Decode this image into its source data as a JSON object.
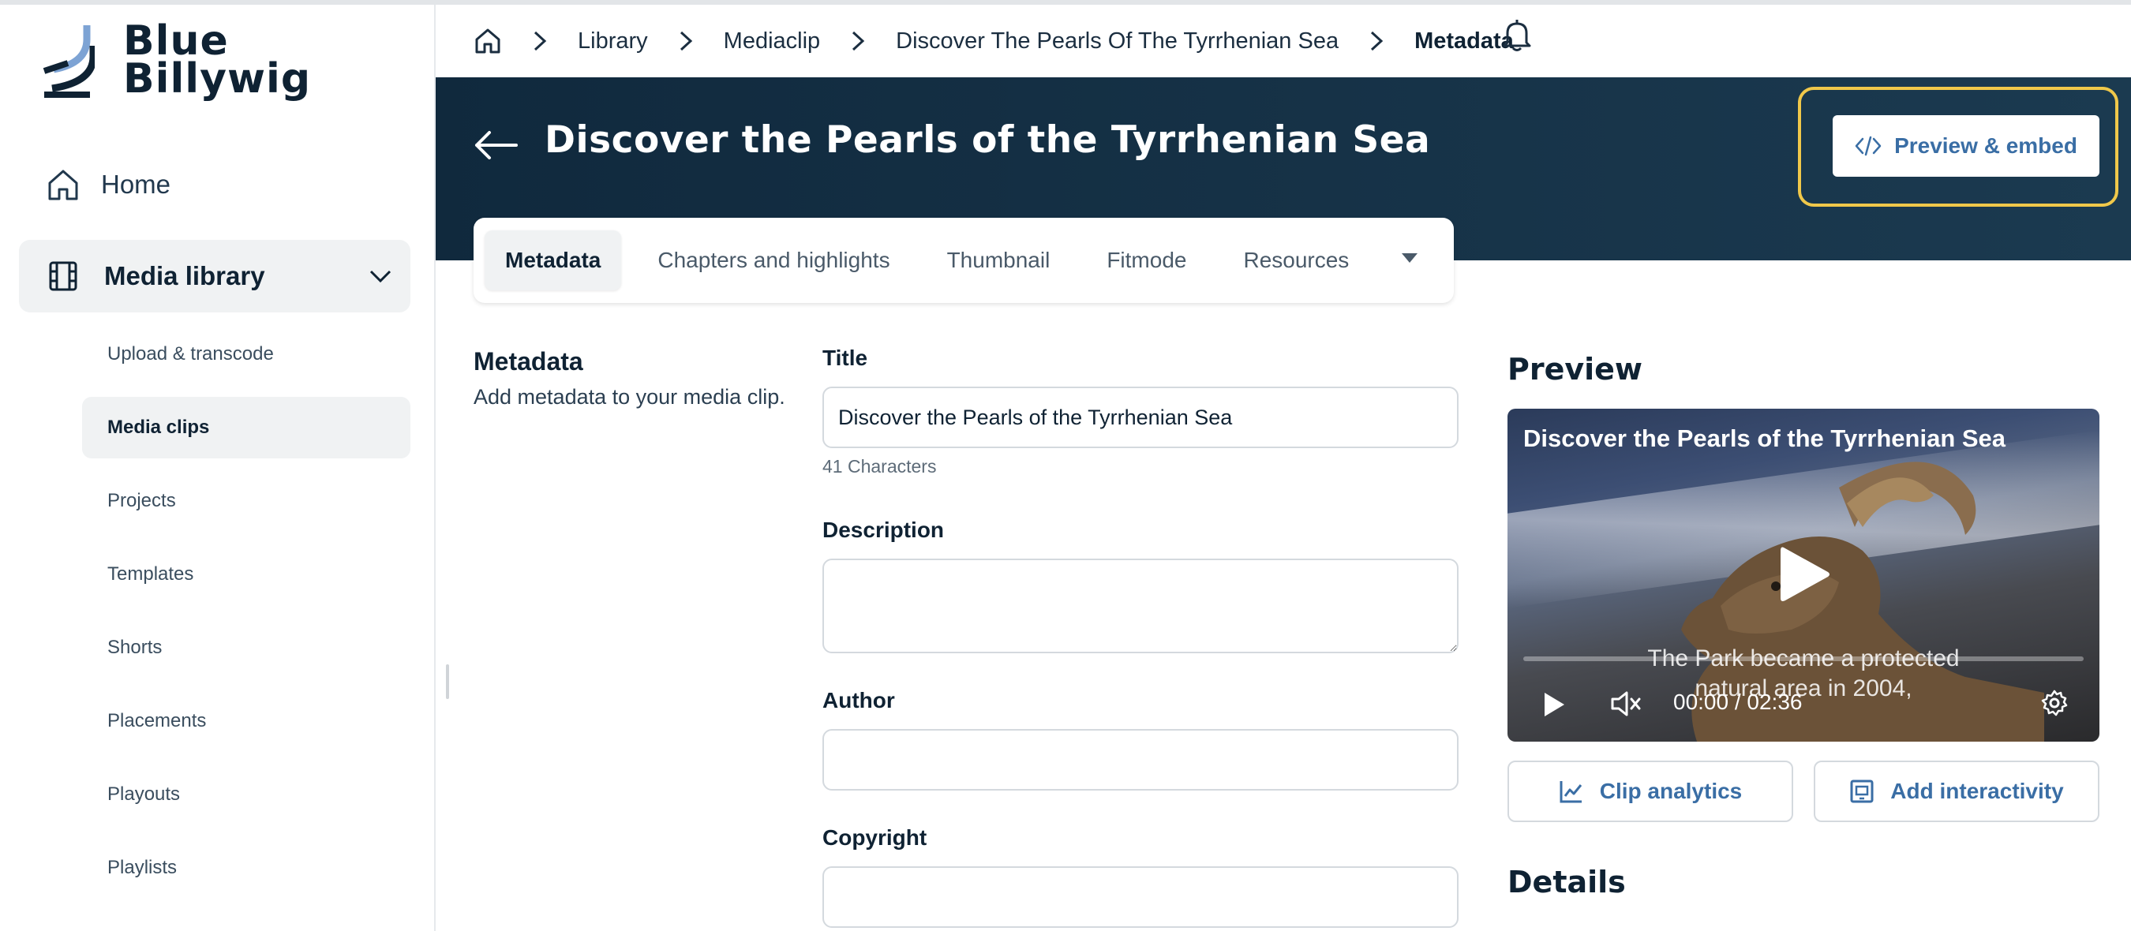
{
  "logo": {
    "line1": "Blue",
    "line2": "Billywig",
    "icon": "brand-swoosh-icon"
  },
  "sidebar": {
    "home_label": "Home",
    "media_library_label": "Media library",
    "items": [
      {
        "label": "Upload & transcode",
        "active": false
      },
      {
        "label": "Media clips",
        "active": true
      },
      {
        "label": "Projects",
        "active": false
      },
      {
        "label": "Templates",
        "active": false
      },
      {
        "label": "Shorts",
        "active": false
      },
      {
        "label": "Placements",
        "active": false
      },
      {
        "label": "Playouts",
        "active": false
      },
      {
        "label": "Playlists",
        "active": false
      }
    ]
  },
  "breadcrumb": {
    "items": [
      "Library",
      "Mediaclip",
      "Discover The Pearls Of The Tyrrhenian Sea"
    ],
    "current": "Metadata"
  },
  "header": {
    "title": "Discover the Pearls of the Tyrrhenian Sea",
    "preview_embed_label": "Preview & embed"
  },
  "tabs": [
    "Metadata",
    "Chapters and highlights",
    "Thumbnail",
    "Fitmode",
    "Resources"
  ],
  "active_tab": "Metadata",
  "metadata_section": {
    "heading": "Metadata",
    "subheading": "Add metadata to your media clip."
  },
  "form": {
    "title_label": "Title",
    "title_value": "Discover the Pearls of the Tyrrhenian Sea",
    "char_count": "41 Characters",
    "description_label": "Description",
    "description_value": "",
    "author_label": "Author",
    "author_value": "",
    "copyright_label": "Copyright",
    "copyright_value": ""
  },
  "preview": {
    "heading": "Preview",
    "video_title": "Discover the Pearls of the Tyrrhenian Sea",
    "caption_line1": "The Park became a protected",
    "caption_line2": "natural area in 2004,",
    "time": "00:00 / 02:36",
    "progress": 0
  },
  "actions": {
    "clip_analytics": "Clip analytics",
    "add_interactivity": "Add interactivity"
  },
  "details_heading": "Details",
  "colors": {
    "accent": "#3a6ea5",
    "header_band": "#14324a",
    "highlight": "#f0c84a",
    "sidebar_active_bg": "#f0f2f3"
  }
}
